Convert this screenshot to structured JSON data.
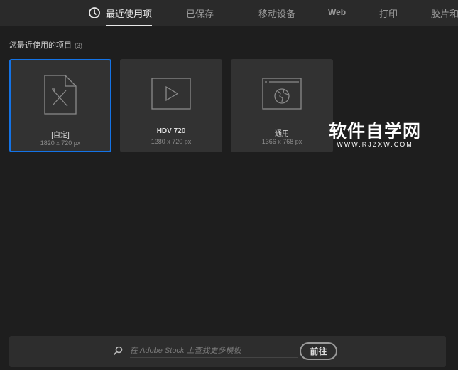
{
  "tabs": [
    {
      "label": "最近使用项",
      "active": true
    },
    {
      "label": "已保存"
    },
    {
      "label": "移动设备"
    },
    {
      "label": "Web"
    },
    {
      "label": "打印"
    },
    {
      "label": "胶片和"
    }
  ],
  "section": {
    "title": "您最近使用的项目",
    "count": "(3)"
  },
  "cards": [
    {
      "name": "[自定]",
      "size": "1820 x 720 px",
      "icon": "custom-document-icon"
    },
    {
      "name": "HDV 720",
      "size": "1280 x 720 px",
      "icon": "video-play-icon"
    },
    {
      "name": "通用",
      "size": "1366 x 768 px",
      "icon": "web-globe-icon"
    }
  ],
  "watermark": {
    "title": "软件自学网",
    "url": "WWW.RJZXW.COM"
  },
  "stock": {
    "placeholder": "在 Adobe Stock 上查找更多模板",
    "button": "前往"
  },
  "colors": {
    "accent": "#1473e6"
  }
}
